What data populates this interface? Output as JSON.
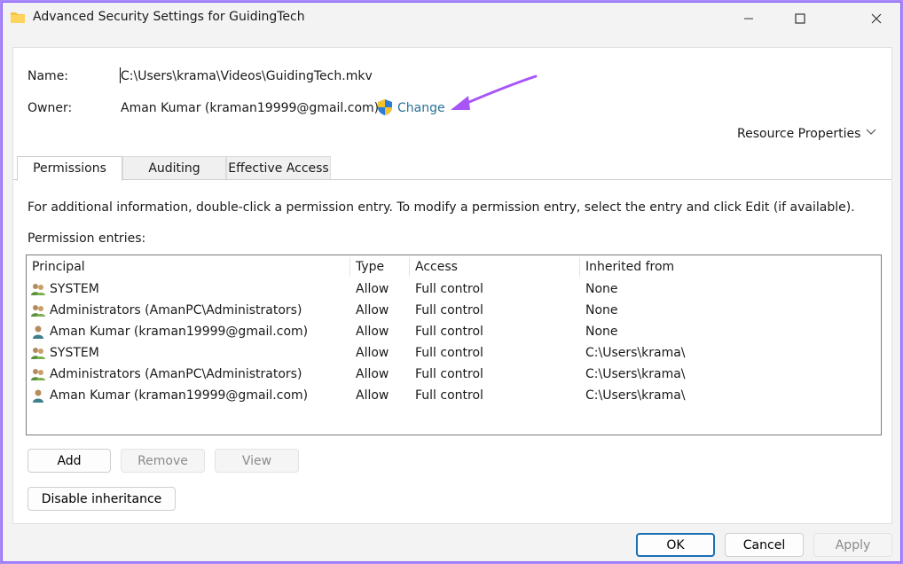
{
  "window": {
    "title": "Advanced Security Settings for GuidingTech"
  },
  "object": {
    "name_label": "Name:",
    "name_value": "C:\\Users\\krama\\Videos\\GuidingTech.mkv",
    "owner_label": "Owner:",
    "owner_value": "Aman Kumar (kraman19999@gmail.com)",
    "change_link": "Change",
    "resource_properties": "Resource Properties"
  },
  "tabs": [
    {
      "label": "Permissions",
      "active": true
    },
    {
      "label": "Auditing",
      "active": false
    },
    {
      "label": "Effective Access",
      "active": false
    }
  ],
  "permissions": {
    "info_text": "For additional information, double-click a permission entry. To modify a permission entry, select the entry and click Edit (if available).",
    "entries_label": "Permission entries:",
    "columns": [
      "Principal",
      "Type",
      "Access",
      "Inherited from"
    ],
    "rows": [
      {
        "principal": "SYSTEM",
        "type": "Allow",
        "access": "Full control",
        "inherited": "None",
        "icon": "group-icon"
      },
      {
        "principal": "Administrators (AmanPC\\Administrators)",
        "type": "Allow",
        "access": "Full control",
        "inherited": "None",
        "icon": "group-icon"
      },
      {
        "principal": "Aman Kumar (kraman19999@gmail.com)",
        "type": "Allow",
        "access": "Full control",
        "inherited": "None",
        "icon": "user-icon"
      },
      {
        "principal": "SYSTEM",
        "type": "Allow",
        "access": "Full control",
        "inherited": "C:\\Users\\krama\\",
        "icon": "group-icon"
      },
      {
        "principal": "Administrators (AmanPC\\Administrators)",
        "type": "Allow",
        "access": "Full control",
        "inherited": "C:\\Users\\krama\\",
        "icon": "group-icon"
      },
      {
        "principal": "Aman Kumar (kraman19999@gmail.com)",
        "type": "Allow",
        "access": "Full control",
        "inherited": "C:\\Users\\krama\\",
        "icon": "user-icon"
      }
    ]
  },
  "buttons": {
    "add": "Add",
    "remove": "Remove",
    "view": "View",
    "disable_inheritance": "Disable inheritance",
    "ok": "OK",
    "cancel": "Cancel",
    "apply": "Apply"
  },
  "colors": {
    "link": "#2a6f97",
    "annotation_arrow": "#a855f7",
    "ok_border": "#1a6fb5"
  }
}
